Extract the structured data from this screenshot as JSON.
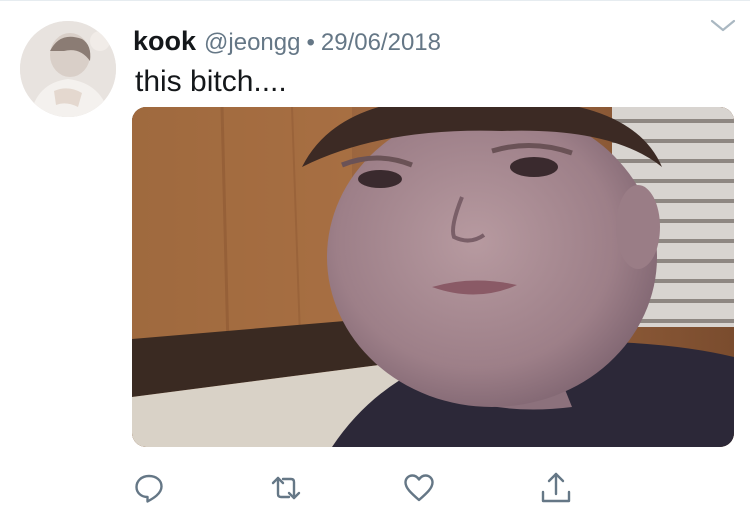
{
  "tweet": {
    "display_name": "kook",
    "handle": "@jeongg",
    "separator": "•",
    "date": "29/06/2018",
    "text": "this bitch...."
  },
  "icons": {
    "menu": "chevron-down-icon",
    "reply": "reply-icon",
    "retweet": "retweet-icon",
    "like": "heart-icon",
    "share": "share-icon"
  },
  "colors": {
    "text_primary": "#14171a",
    "text_secondary": "#657786",
    "icon": "#657786"
  }
}
